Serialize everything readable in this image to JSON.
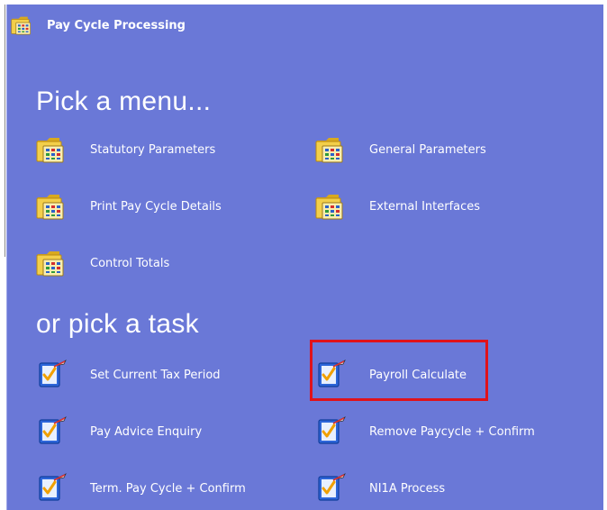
{
  "window": {
    "title": "Pay Cycle Processing",
    "title_icon": "folder-menu-icon"
  },
  "menus": {
    "heading": "Pick a menu...",
    "items": [
      {
        "label": "Statutory Parameters",
        "icon": "folder-menu-icon"
      },
      {
        "label": "General Parameters",
        "icon": "folder-menu-icon"
      },
      {
        "label": "Print Pay Cycle Details",
        "icon": "folder-menu-icon"
      },
      {
        "label": "External Interfaces",
        "icon": "folder-menu-icon"
      },
      {
        "label": "Control Totals",
        "icon": "folder-menu-icon"
      }
    ]
  },
  "tasks": {
    "heading": "or pick a task",
    "items": [
      {
        "label": "Set Current Tax Period",
        "icon": "task-check-icon"
      },
      {
        "label": "Payroll Calculate",
        "icon": "task-check-icon",
        "highlighted": true
      },
      {
        "label": "Pay Advice Enquiry",
        "icon": "task-check-icon"
      },
      {
        "label": "Remove Paycycle + Confirm",
        "icon": "task-check-icon"
      },
      {
        "label": "Term. Pay Cycle + Confirm",
        "icon": "task-check-icon"
      },
      {
        "label": "NI1A Process",
        "icon": "task-check-icon"
      }
    ]
  },
  "colors": {
    "background": "#6a78d7",
    "text": "#ffffff",
    "highlight": "#e0121a"
  }
}
